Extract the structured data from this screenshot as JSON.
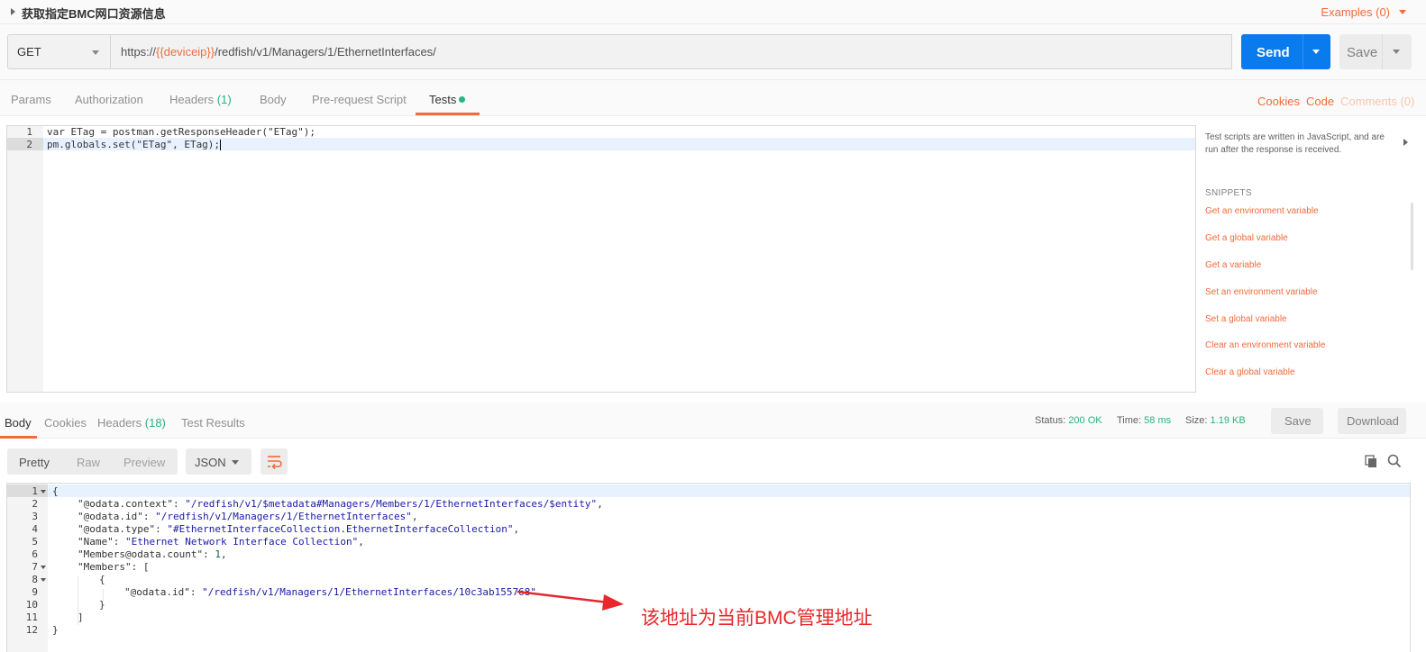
{
  "request": {
    "title": "获取指定BMC网口资源信息",
    "examples_label": "Examples (0)",
    "method": "GET",
    "url_prefix": "https://",
    "url_var": "{{deviceip}}",
    "url_path": "/redfish/v1/Managers/1/EthernetInterfaces/",
    "send_label": "Send",
    "save_label": "Save"
  },
  "request_tabs": [
    {
      "label": "Params"
    },
    {
      "label": "Authorization"
    },
    {
      "label": "Headers",
      "count": "(1)"
    },
    {
      "label": "Body"
    },
    {
      "label": "Pre-request Script"
    },
    {
      "label": "Tests"
    }
  ],
  "request_links": {
    "cookies": "Cookies",
    "code": "Code",
    "comments": "Comments (0)"
  },
  "editor": {
    "lines": [
      {
        "num": "1",
        "code": "var ETag = postman.getResponseHeader(\"ETag\");"
      },
      {
        "num": "2",
        "code": "pm.globals.set(\"ETag\", ETag);"
      }
    ]
  },
  "sidebar": {
    "help": "Test scripts are written in JavaScript, and are run after the response is received.",
    "snippets_title": "SNIPPETS",
    "snippets": [
      "Get an environment variable",
      "Get a global variable",
      "Get a variable",
      "Set an environment variable",
      "Set a global variable",
      "Clear an environment variable",
      "Clear a global variable"
    ]
  },
  "response_tabs": [
    {
      "label": "Body"
    },
    {
      "label": "Cookies"
    },
    {
      "label": "Headers",
      "count": "(18)"
    },
    {
      "label": "Test Results"
    }
  ],
  "response_meta": {
    "status_label": "Status:",
    "status_value": "200 OK",
    "time_label": "Time:",
    "time_value": "58 ms",
    "size_label": "Size:",
    "size_value": "1.19 KB",
    "save_label": "Save",
    "download_label": "Download"
  },
  "format": {
    "pretty": "Pretty",
    "raw": "Raw",
    "preview": "Preview",
    "type": "JSON"
  },
  "response_body": {
    "lines": [
      {
        "num": "1",
        "text": "{"
      },
      {
        "num": "2",
        "key": "\"@odata.context\"",
        "value": "\"/redfish/v1/$metadata#Managers/Members/1/EthernetInterfaces/$entity\"",
        "tail": ","
      },
      {
        "num": "3",
        "key": "\"@odata.id\"",
        "value": "\"/redfish/v1/Managers/1/EthernetInterfaces\"",
        "tail": ","
      },
      {
        "num": "4",
        "key": "\"@odata.type\"",
        "value": "\"#EthernetInterfaceCollection.EthernetInterfaceCollection\"",
        "tail": ","
      },
      {
        "num": "5",
        "key": "\"Name\"",
        "value": "\"Ethernet Network Interface Collection\"",
        "tail": ","
      },
      {
        "num": "6",
        "key": "\"Members@odata.count\"",
        "number": "1",
        "tail": ","
      },
      {
        "num": "7",
        "key": "\"Members\"",
        "text": "["
      },
      {
        "num": "8",
        "text": "{"
      },
      {
        "num": "9",
        "key": "\"@odata.id\"",
        "value": "\"/redfish/v1/Managers/1/EthernetInterfaces/10c3ab155768\""
      },
      {
        "num": "10",
        "text": "}"
      },
      {
        "num": "11",
        "text": "]"
      },
      {
        "num": "12",
        "text": "}"
      }
    ]
  },
  "annotation": {
    "text": "该地址为当前BMC管理地址",
    "color": "#e8262b"
  },
  "colors": {
    "accent": "#f26b3a",
    "send": "#097bed",
    "success": "#26b47f"
  }
}
